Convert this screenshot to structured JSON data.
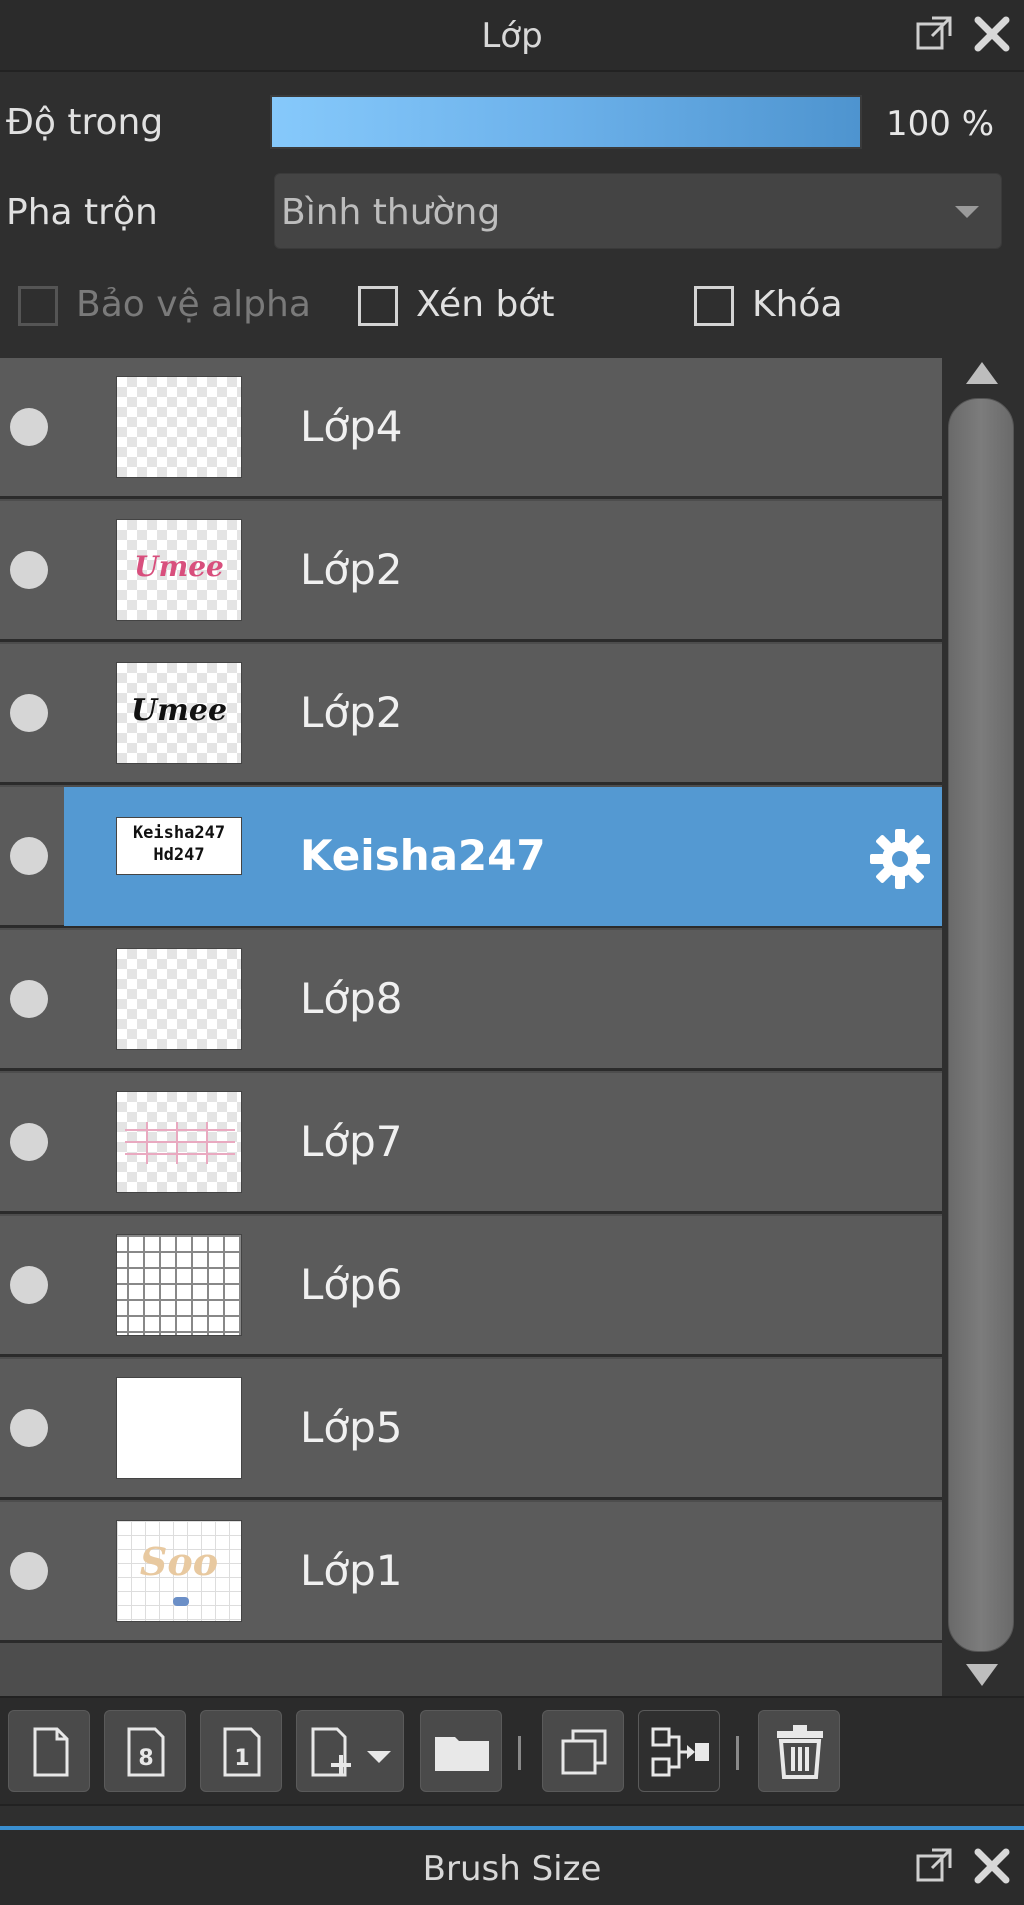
{
  "header": {
    "title": "Lớp"
  },
  "opacity": {
    "label": "Độ trong",
    "value": "100 %",
    "level_percent": 100
  },
  "blend": {
    "label": "Pha trộn",
    "value": "Bình thường"
  },
  "options": {
    "alpha_protect": "Bảo vệ alpha",
    "clipping": "Xén bớt",
    "lock": "Khóa"
  },
  "layers": [
    {
      "name": "Lớp4",
      "thumb": "empty"
    },
    {
      "name": "Lớp2",
      "thumb": "umee-pink",
      "thumb_text": "Umee"
    },
    {
      "name": "Lớp2",
      "thumb": "umee-black",
      "thumb_text": "Umee"
    },
    {
      "name": "Keisha247",
      "thumb": "keisha",
      "thumb_text": "Keisha247\nHd247",
      "selected": true
    },
    {
      "name": "Lớp8",
      "thumb": "empty"
    },
    {
      "name": "Lớp7",
      "thumb": "pink-lines"
    },
    {
      "name": "Lớp6",
      "thumb": "grid"
    },
    {
      "name": "Lớp5",
      "thumb": "white"
    },
    {
      "name": "Lớp1",
      "thumb": "soo",
      "thumb_text": "Soo"
    }
  ],
  "toolbar": {
    "buttons": [
      "new-layer-icon",
      "new-8bit-layer-icon",
      "new-1bit-layer-icon",
      "add-layer-dropdown-icon",
      "new-folder-icon",
      "duplicate-layer-icon",
      "merge-down-icon",
      "delete-layer-icon"
    ]
  },
  "footer": {
    "title": "Brush Size"
  },
  "colors": {
    "selected": "#5499d2",
    "accent": "#3a8fd0",
    "panel": "#2b2b2b",
    "layer_bg": "#5b5b5b"
  }
}
